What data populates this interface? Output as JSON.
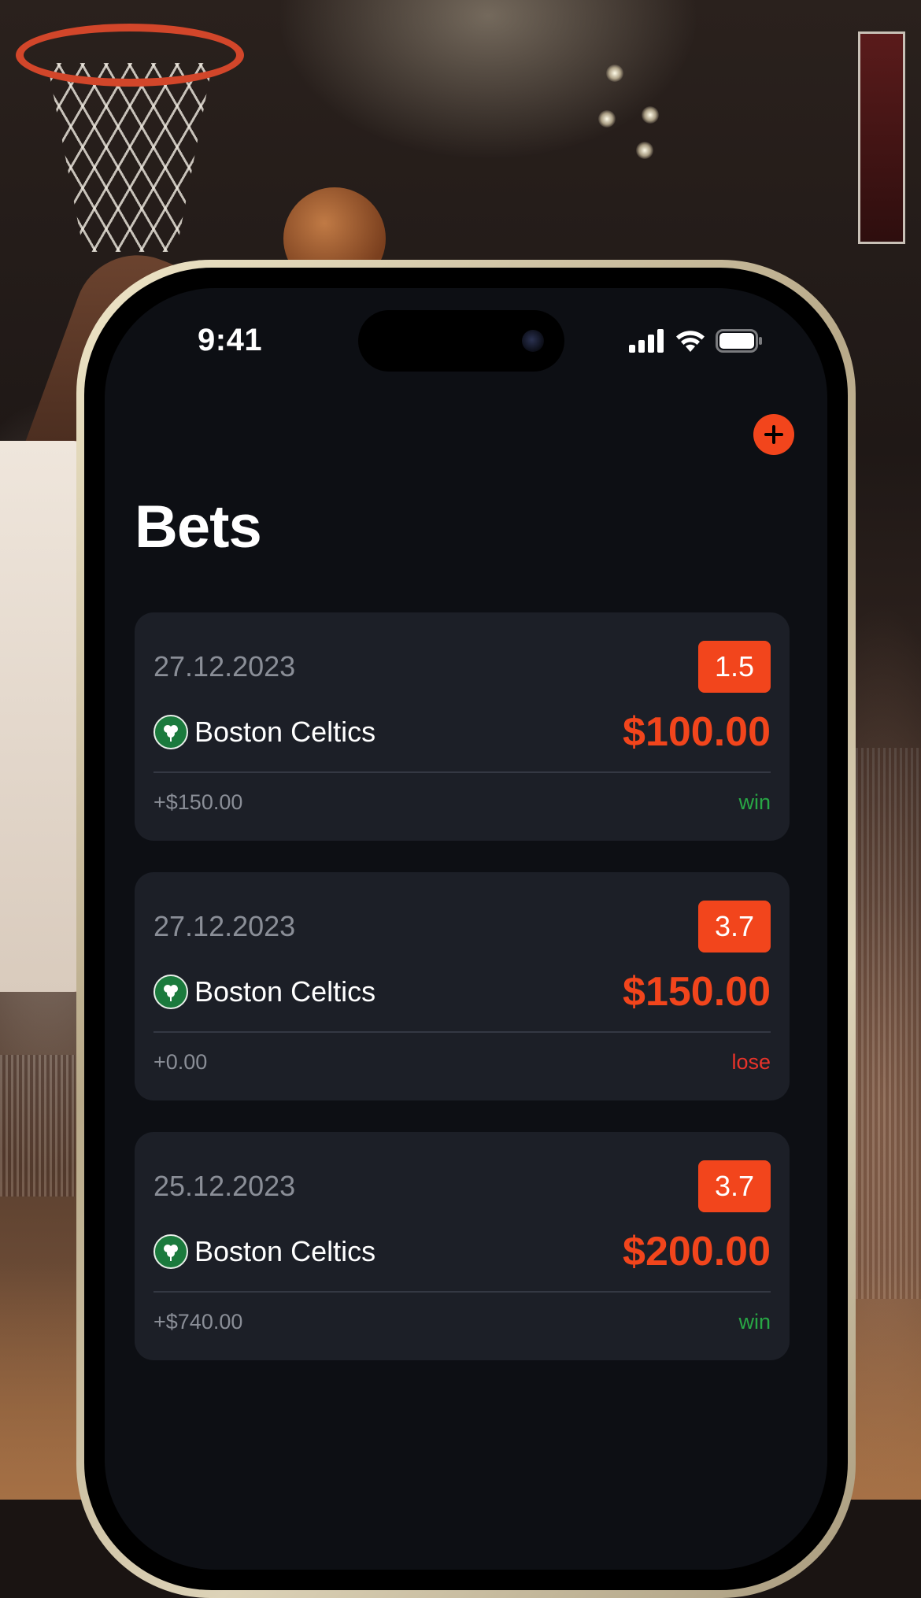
{
  "status_bar": {
    "time": "9:41"
  },
  "header": {
    "title": "Bets",
    "add_button_label": "+"
  },
  "colors": {
    "accent": "#f2451c",
    "win": "#28a745",
    "lose": "#e8332a",
    "card": "#1c1f27",
    "screen": "#0d0f14"
  },
  "bets": [
    {
      "date": "27.12.2023",
      "odds": "1.5",
      "team": "Boston Celtics",
      "amount": "$100.00",
      "payout": "+$150.00",
      "result": "win"
    },
    {
      "date": "27.12.2023",
      "odds": "3.7",
      "team": "Boston Celtics",
      "amount": "$150.00",
      "payout": "+0.00",
      "result": "lose"
    },
    {
      "date": "25.12.2023",
      "odds": "3.7",
      "team": "Boston Celtics",
      "amount": "$200.00",
      "payout": "+$740.00",
      "result": "win"
    }
  ],
  "icons": [
    "signal-icon",
    "wifi-icon",
    "battery-icon",
    "plus-icon",
    "celtics-logo-icon"
  ]
}
